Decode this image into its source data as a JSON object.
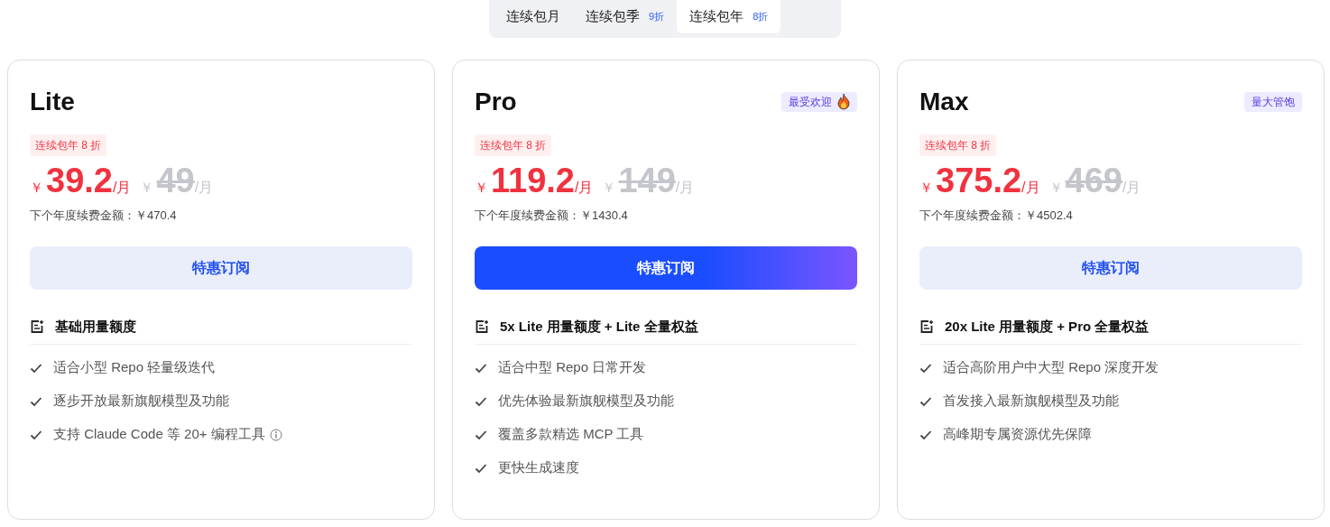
{
  "tabs": [
    {
      "label": "连续包月",
      "selected": false
    },
    {
      "label": "连续包季",
      "discount": "9折",
      "selected": false
    },
    {
      "label": "连续包年",
      "discount": "8折",
      "selected": true
    }
  ],
  "plans": [
    {
      "name": "Lite",
      "promo": "连续包年 8 折",
      "currency": "￥",
      "price": "39.2",
      "unit": "/月",
      "original_currency": "￥",
      "original_price": "49",
      "original_unit": "/月",
      "renewal": "下个年度续费金额：￥470.4",
      "button": {
        "label": "特惠订阅",
        "kind": "soft"
      },
      "quota": "基础用量额度",
      "features": [
        {
          "text": "适合小型 Repo 轻量级迭代"
        },
        {
          "text": "逐步开放最新旗舰模型及功能"
        },
        {
          "text": "支持 Claude Code 等 20+ 编程工具",
          "info": true
        }
      ]
    },
    {
      "name": "Pro",
      "badge": {
        "text": "最受欢迎",
        "kind": "fire"
      },
      "promo": "连续包年 8 折",
      "currency": "￥",
      "price": "119.2",
      "unit": "/月",
      "original_currency": "￥",
      "original_price": "149",
      "original_unit": "/月",
      "renewal": "下个年度续费金额：￥1430.4",
      "button": {
        "label": "特惠订阅",
        "kind": "primary"
      },
      "quota": "5x Lite 用量额度 + Lite 全量权益",
      "features": [
        {
          "text": "适合中型 Repo 日常开发"
        },
        {
          "text": "优先体验最新旗舰模型及功能"
        },
        {
          "text": "覆盖多款精选 MCP 工具"
        },
        {
          "text": "更快生成速度"
        }
      ]
    },
    {
      "name": "Max",
      "badge": {
        "text": "量大管饱"
      },
      "promo": "连续包年 8 折",
      "currency": "￥",
      "price": "375.2",
      "unit": "/月",
      "original_currency": "￥",
      "original_price": "469",
      "original_unit": "/月",
      "renewal": "下个年度续费金额：￥4502.4",
      "button": {
        "label": "特惠订阅",
        "kind": "soft"
      },
      "quota": "20x Lite 用量额度 + Pro 全量权益",
      "features": [
        {
          "text": "适合高阶用户中大型 Repo 深度开发"
        },
        {
          "text": "首发接入最新旗舰模型及功能"
        },
        {
          "text": "高峰期专属资源优先保障"
        }
      ]
    }
  ]
}
